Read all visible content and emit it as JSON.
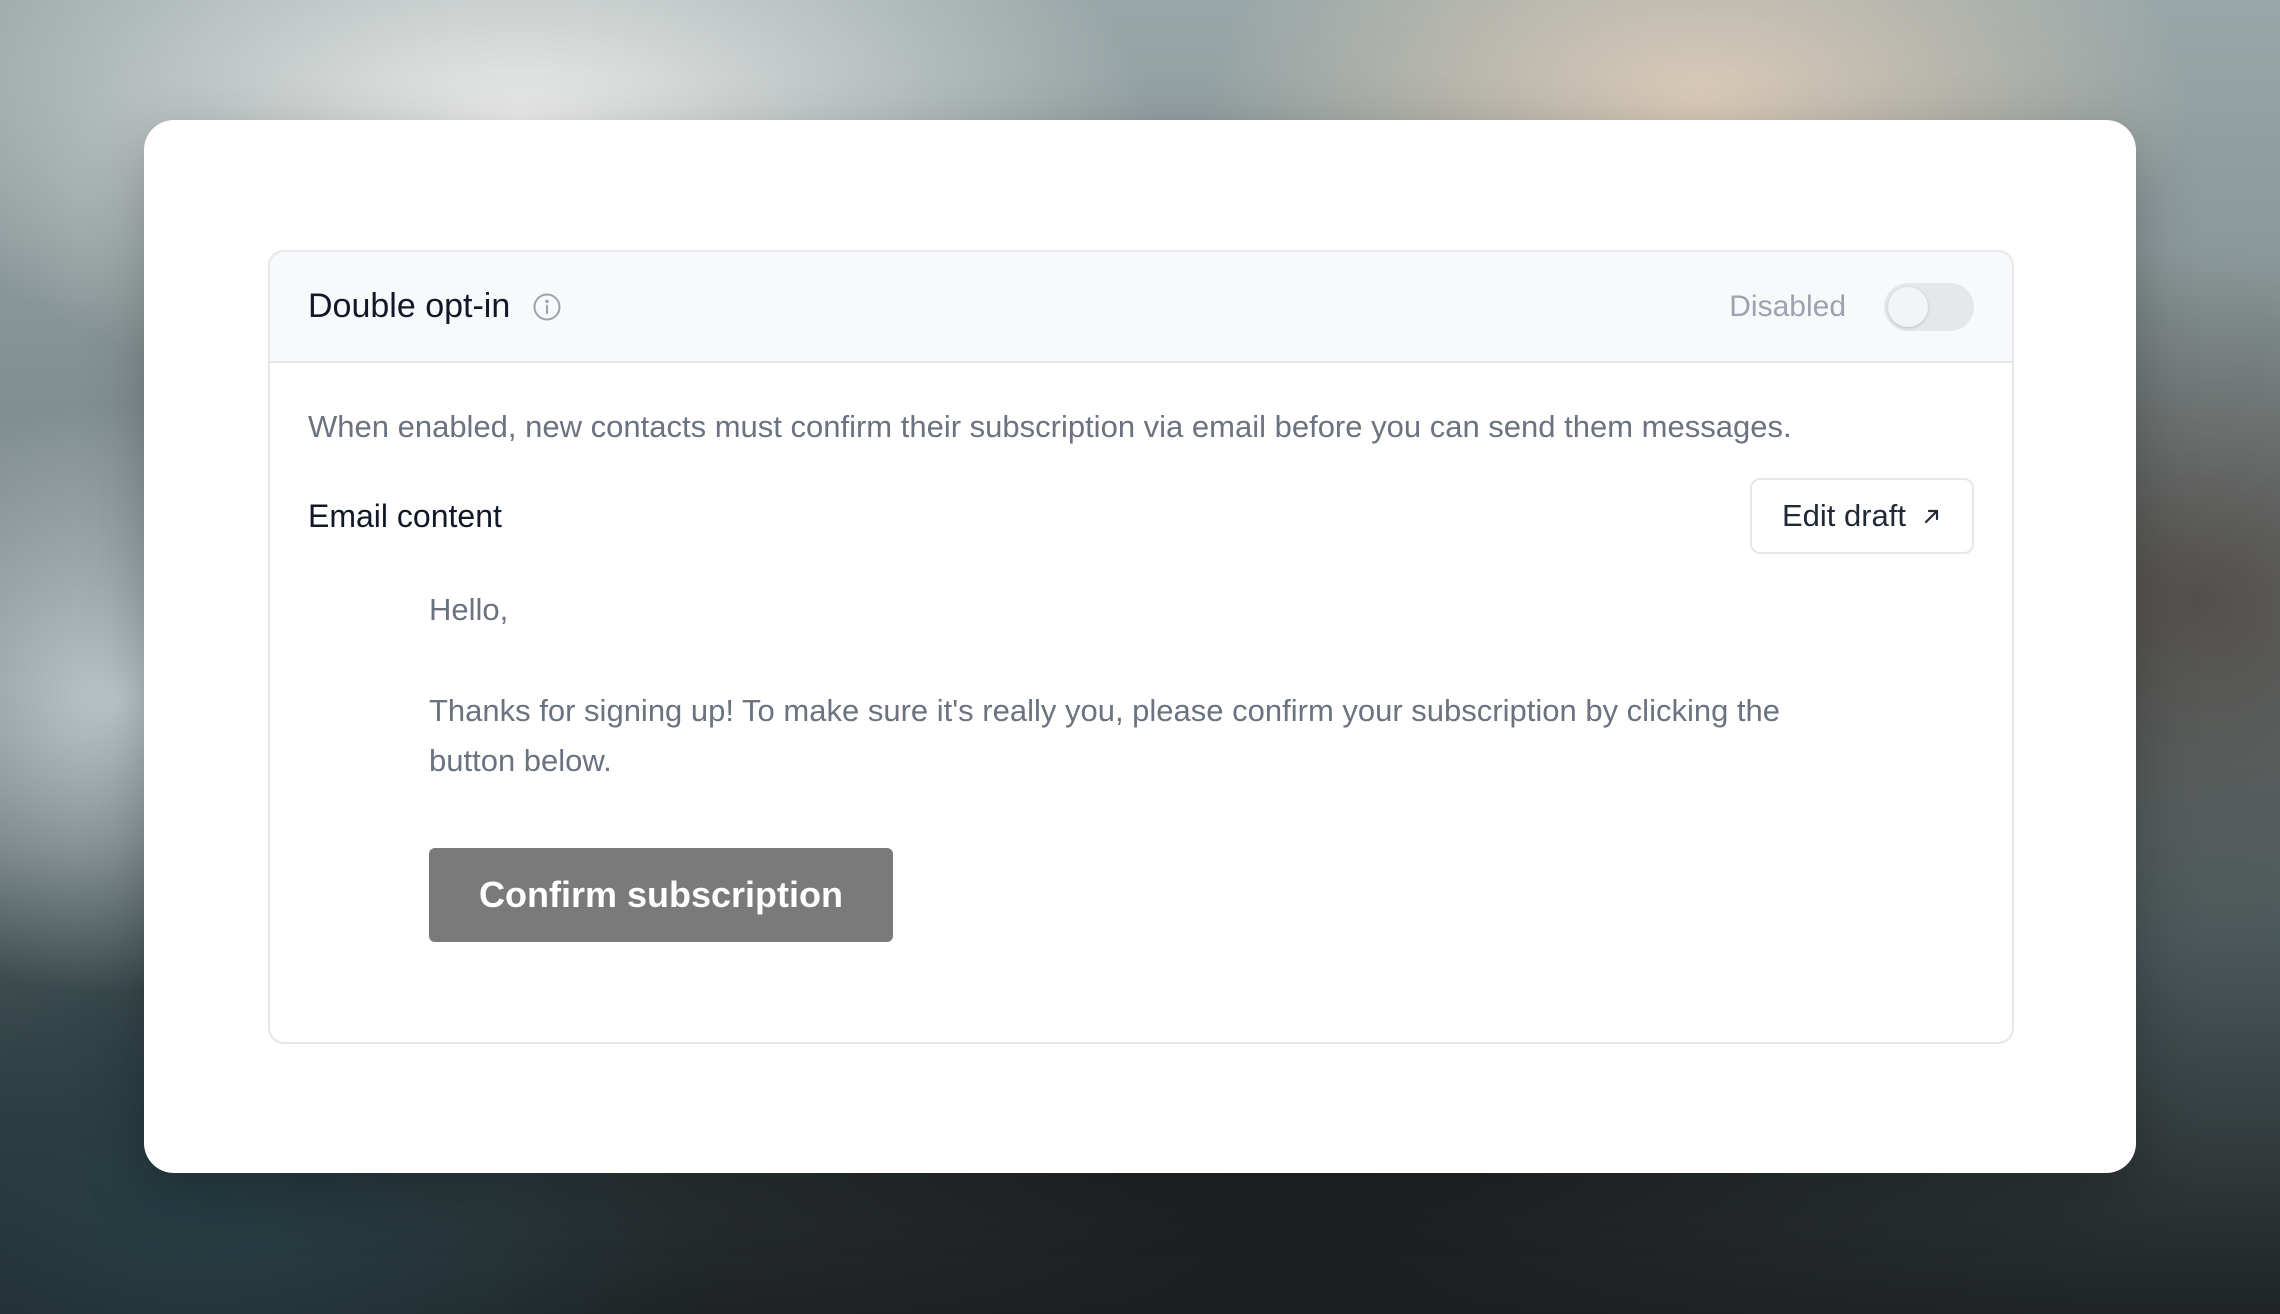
{
  "header": {
    "title": "Double opt-in",
    "info_icon": "info-circle-icon",
    "status": "Disabled",
    "toggle_enabled": false
  },
  "description": "When enabled, new contacts must confirm their subscription via email before you can send them messages.",
  "email_content": {
    "label": "Email content",
    "edit_button_label": "Edit draft",
    "edit_button_icon": "arrow-up-right-icon"
  },
  "preview": {
    "greeting": "Hello,",
    "body": "Thanks for signing up! To make sure it's really you, please confirm your subscription by clicking the button below.",
    "button_label": "Confirm subscription",
    "button_color": "#7a7a7a"
  }
}
